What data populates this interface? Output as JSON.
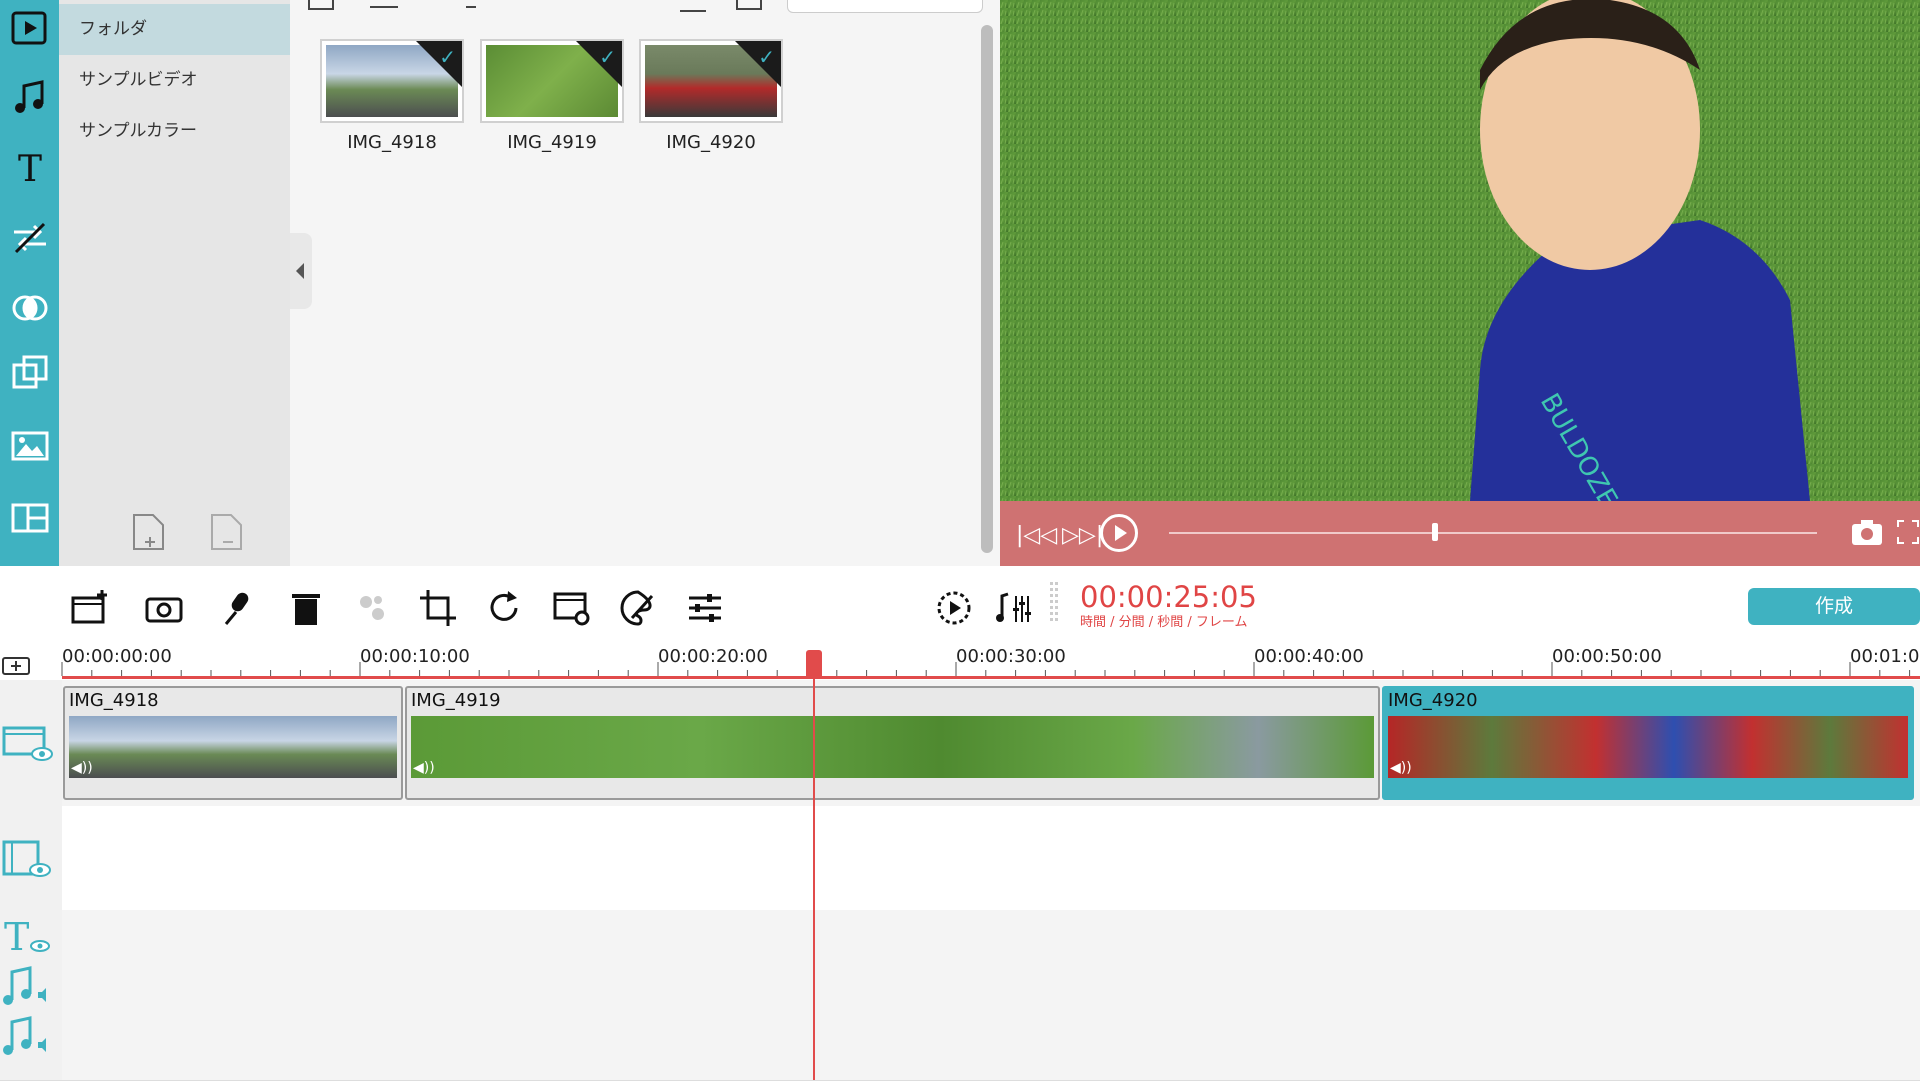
{
  "sidebar": {
    "icons": [
      "media-icon",
      "audio-icon",
      "title-icon",
      "transition-icon",
      "filter-icon",
      "overlay-icon",
      "element-icon",
      "split-screen-icon"
    ]
  },
  "folders": {
    "items": [
      {
        "label": "フォルダ",
        "selected": true
      },
      {
        "label": "サンプルビデオ",
        "selected": false
      },
      {
        "label": "サンプルカラー",
        "selected": false
      }
    ]
  },
  "library": {
    "thumbnails": [
      {
        "label": "IMG_4918"
      },
      {
        "label": "IMG_4919"
      },
      {
        "label": "IMG_4920"
      }
    ]
  },
  "preview": {
    "progress_percent": 41
  },
  "toolbar": {
    "timecode": "00:00:25:05",
    "timecode_sub": "時間 / 分間 / 秒間 / フレーム",
    "create_label": "作成"
  },
  "ruler": {
    "ticks": [
      "00:00:00:00",
      "00:00:10:00",
      "00:00:20:00",
      "00:00:30:00",
      "00:00:40:00",
      "00:00:50:00",
      "00:01:0"
    ]
  },
  "timeline": {
    "clips": [
      {
        "name": "IMG_4918"
      },
      {
        "name": "IMG_4919"
      },
      {
        "name": "IMG_4920"
      }
    ]
  },
  "colors": {
    "accent": "#3fb2c1",
    "preview_controls": "#cf7272",
    "playhead": "#e14b4b",
    "timecode": "#e04545"
  }
}
